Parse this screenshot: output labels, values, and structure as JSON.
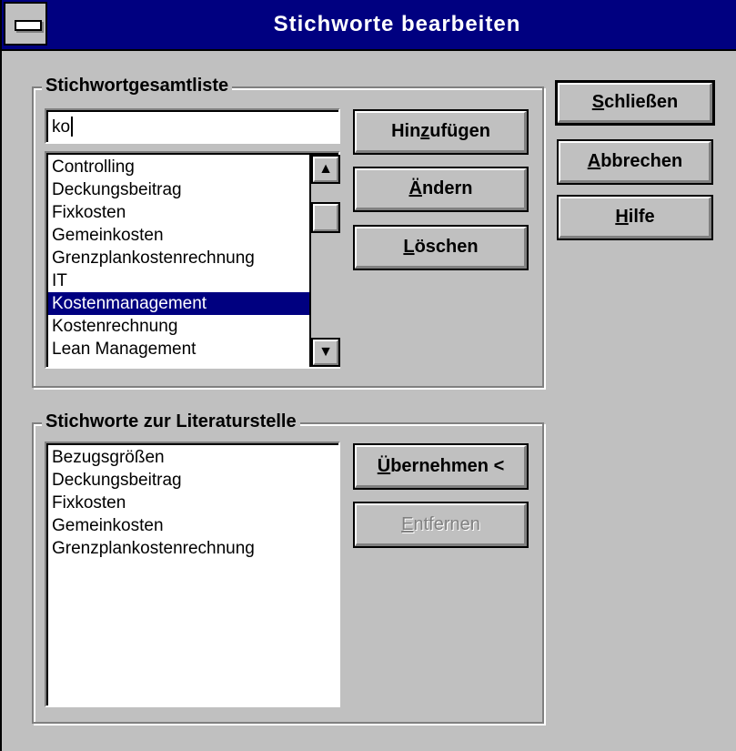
{
  "window": {
    "title": "Stichworte bearbeiten"
  },
  "master_group": {
    "label": "Stichwortgesamtliste",
    "input_value": "ko",
    "items": [
      "Controlling",
      "Deckungsbeitrag",
      "Fixkosten",
      "Gemeinkosten",
      "Grenzplankostenrechnung",
      "IT",
      "Kostenmanagement",
      "Kostenrechnung",
      "Lean Management"
    ],
    "selected_index": 6,
    "buttons": {
      "add": {
        "pre": "Hin",
        "key": "z",
        "post": "ufügen"
      },
      "change": {
        "pre": "",
        "key": "Ä",
        "post": "ndern"
      },
      "delete": {
        "pre": "",
        "key": "L",
        "post": "öschen"
      }
    }
  },
  "ref_group": {
    "label": "Stichworte zur Literaturstelle",
    "items": [
      "Bezugsgrößen",
      "Deckungsbeitrag",
      "Fixkosten",
      "Gemeinkosten",
      "Grenzplankostenrechnung"
    ],
    "buttons": {
      "take": {
        "pre": "",
        "key": "Ü",
        "post": "bernehmen <"
      },
      "remove": {
        "pre": "",
        "key": "E",
        "post": "ntfernen"
      }
    }
  },
  "side_buttons": {
    "close": {
      "pre": "",
      "key": "S",
      "post": "chließen"
    },
    "cancel": {
      "pre": "",
      "key": "A",
      "post": "bbrechen"
    },
    "help": {
      "pre": "",
      "key": "H",
      "post": "ilfe"
    }
  },
  "icons": {
    "scroll_up": "▲",
    "scroll_down": "▼"
  }
}
